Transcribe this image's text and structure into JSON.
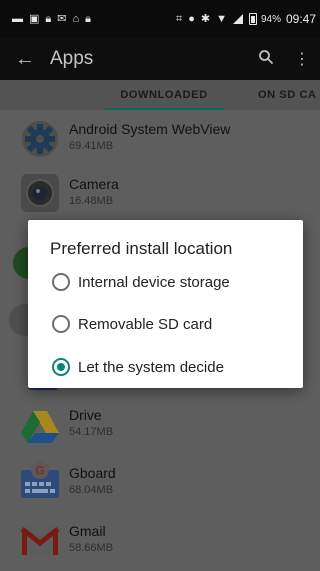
{
  "status_bar": {
    "icons": [
      "message-icon",
      "image-icon",
      "lock-icon",
      "gmail-icon",
      "hanger-icon",
      "lock-icon",
      "scan-icon",
      "location-icon",
      "bluetooth-icon",
      "wifi-icon",
      "signal-icon",
      "battery-icon"
    ],
    "battery": "94%",
    "time": "09:47"
  },
  "app_bar": {
    "title": "Apps",
    "back_icon": "arrow-back-icon",
    "search_icon": "search-icon",
    "menu_icon": "more-vert-icon"
  },
  "tabs": [
    {
      "label": "DOWNLOADED",
      "active": true
    },
    {
      "label": "ON SD CA",
      "active": false
    }
  ],
  "apps": [
    {
      "name": "Android System WebView",
      "size": "69.41MB",
      "icon": "gear-icon"
    },
    {
      "name": "Camera",
      "size": "16.48MB",
      "icon": "camera-icon"
    },
    {
      "name": "Drive",
      "size": "54.17MB",
      "icon": "drive-icon"
    },
    {
      "name": "Gboard",
      "size": "68.04MB",
      "icon": "gboard-icon"
    },
    {
      "name": "Gmail",
      "size": "58.66MB",
      "icon": "gmail-icon"
    }
  ],
  "dialog": {
    "title": "Preferred install location",
    "options": [
      {
        "label": "Internal device storage",
        "selected": false
      },
      {
        "label": "Removable SD card",
        "selected": false
      },
      {
        "label": "Let the system decide",
        "selected": true
      }
    ]
  },
  "colors": {
    "accent": "#0a8574",
    "tab_indicator": "#0a6b5d"
  }
}
